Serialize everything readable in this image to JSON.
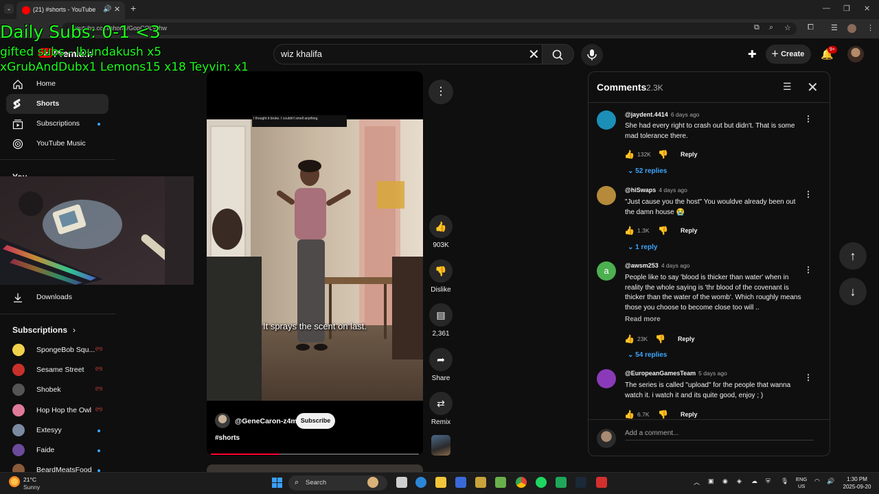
{
  "browser": {
    "tab_title": "(21) #shorts - YouTube",
    "url": "youtube.com/shorts/GopCOLvvhw"
  },
  "overlay": {
    "line1": "Daily Subs: 0-1 <3",
    "line2": "gifted subs - lbundakush x5",
    "line3": "xGrubAndDubx1 Lemons15 x18 Teyvin: x1"
  },
  "masthead": {
    "logo_text": "Premium",
    "search_value": "wiz khalifa",
    "create_label": "Create",
    "notification_count": "9+"
  },
  "sidebar": {
    "items": [
      {
        "label": "Home",
        "icon": "home-icon"
      },
      {
        "label": "Shorts",
        "icon": "shorts-icon"
      },
      {
        "label": "Subscriptions",
        "icon": "subscriptions-icon"
      },
      {
        "label": "YouTube Music",
        "icon": "youtube-music-icon"
      }
    ],
    "you_label": "You",
    "downloads_label": "Downloads",
    "subscriptions_header": "Subscriptions",
    "channels": [
      {
        "name": "SpongeBob Squ...",
        "status": "live",
        "color": "#f2d14b"
      },
      {
        "name": "Sesame Street",
        "status": "live",
        "color": "#c8302a"
      },
      {
        "name": "Shobek",
        "status": "live",
        "color": "#555555"
      },
      {
        "name": "Hop Hop the Owl",
        "status": "live",
        "color": "#e07a9a"
      },
      {
        "name": "Extesyy",
        "status": "new",
        "color": "#7a8aa0"
      },
      {
        "name": "Faide",
        "status": "new",
        "color": "#6a4a9a"
      },
      {
        "name": "BeardMeatsFood",
        "status": "new",
        "color": "#8a5a3a"
      }
    ]
  },
  "video": {
    "caption_box": "I thought it broke. I couldn't smell anything.",
    "subtitle": "It sprays the scent on last.",
    "channel": "@GeneCaron-z4m",
    "subscribe_label": "Subscribe",
    "hashtag": "#shorts",
    "progress": 0.33
  },
  "actions": {
    "like_count": "903K",
    "dislike_label": "Dislike",
    "comment_count": "2,361",
    "share_label": "Share",
    "remix_label": "Remix"
  },
  "comments": {
    "title": "Comments",
    "count": "2.3K",
    "add_placeholder": "Add a comment...",
    "reply_label": "Reply",
    "read_more": "Read more",
    "items": [
      {
        "author": "@jaydent.4414",
        "time": "6 days ago",
        "text": "She had every right to crash out but didn't. That is some mad tolerance there.",
        "likes": "132K",
        "replies": "52 replies",
        "avatar_color": "#1b8fb8",
        "avatar_letter": ""
      },
      {
        "author": "@hiSwaps",
        "time": "4 days ago",
        "text": "\"Just cause you the host\" You wouldve already been out the damn house 😭",
        "likes": "1.3K",
        "replies": "1 reply",
        "avatar_color": "#b58a3a",
        "avatar_letter": ""
      },
      {
        "author": "@awsm253",
        "time": "4 days ago",
        "text": "People like to say 'blood is thicker than water' when in reality the whole saying is 'thr blood of the covenant is thicker than the water of the womb'. Which roughly means those you choose to become close too will ..",
        "likes": "23K",
        "replies": "54 replies",
        "avatar_color": "#4caf50",
        "avatar_letter": "a"
      },
      {
        "author": "@EuropeanGamesTeam",
        "time": "5 days ago",
        "text": "The series is called \"upload\" for the people that wanna watch it. i watch it and its quite good, enjoy ; )",
        "likes": "6.7K",
        "replies": "",
        "avatar_color": "#8a3ab8",
        "avatar_letter": ""
      }
    ]
  },
  "taskbar": {
    "temp": "21°C",
    "condition": "Sunny",
    "search_label": "Search",
    "lang_1": "ENG",
    "lang_2": "US",
    "time": "1:30 PM",
    "date": "2025-09-20"
  },
  "colors": {
    "accent_blue": "#3ea6ff",
    "yt_red": "#ff0000",
    "overlay_green": "#1dff1d"
  }
}
